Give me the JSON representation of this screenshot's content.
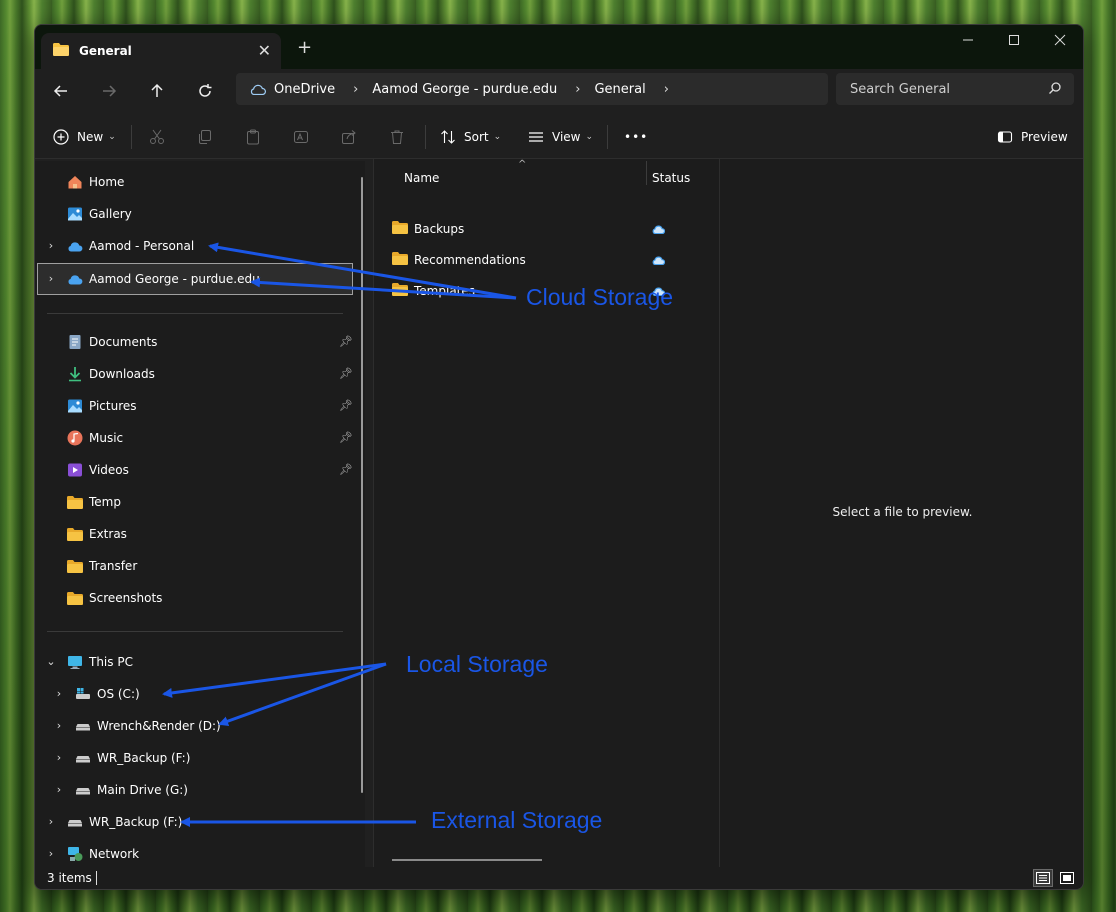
{
  "window": {
    "tab_title": "General",
    "new_tab_symbol": "+",
    "close_tab_symbol": "✕"
  },
  "nav": {
    "breadcrumbs": [
      "OneDrive",
      "Aamod George - purdue.edu",
      "General"
    ],
    "search_placeholder": "Search General"
  },
  "toolbar": {
    "new_label": "New",
    "sort_label": "Sort",
    "view_label": "View",
    "more_label": "•••",
    "preview_label": "Preview"
  },
  "sidebar": {
    "quick": [
      {
        "label": "Home",
        "icon": "home-icon"
      },
      {
        "label": "Gallery",
        "icon": "gallery-icon"
      },
      {
        "label": "Aamod - Personal",
        "icon": "onedrive-icon"
      },
      {
        "label": "Aamod George - purdue.edu",
        "icon": "onedrive-icon"
      }
    ],
    "pinned": [
      {
        "label": "Documents",
        "icon": "documents-icon"
      },
      {
        "label": "Downloads",
        "icon": "downloads-icon"
      },
      {
        "label": "Pictures",
        "icon": "pictures-icon"
      },
      {
        "label": "Music",
        "icon": "music-icon"
      },
      {
        "label": "Videos",
        "icon": "videos-icon"
      },
      {
        "label": "Temp",
        "icon": "folder-icon"
      },
      {
        "label": "Extras",
        "icon": "folder-icon"
      },
      {
        "label": "Transfer",
        "icon": "folder-icon"
      },
      {
        "label": "Screenshots",
        "icon": "folder-icon"
      }
    ],
    "this_pc": "This PC",
    "drives": [
      {
        "label": "OS (C:)",
        "icon": "os-drive-icon"
      },
      {
        "label": "Wrench&Render (D:)",
        "icon": "drive-icon"
      },
      {
        "label": "WR_Backup (F:)",
        "icon": "drive-icon"
      },
      {
        "label": "Main Drive (G:)",
        "icon": "drive-icon"
      }
    ],
    "external": {
      "label": "WR_Backup (F:)",
      "icon": "drive-icon"
    },
    "network": {
      "label": "Network",
      "icon": "network-icon"
    }
  },
  "filelist": {
    "col_name": "Name",
    "col_status": "Status",
    "files": [
      {
        "name": "Backups",
        "status": "cloud-only"
      },
      {
        "name": "Recommendations",
        "status": "cloud-only"
      },
      {
        "name": "Templates",
        "status": "cloud-only"
      }
    ]
  },
  "preview": {
    "message": "Select a file to preview."
  },
  "status": {
    "items": "3 items"
  },
  "annotations": {
    "cloud": "Cloud Storage",
    "local": "Local Storage",
    "external": "External Storage"
  },
  "colors": {
    "accent": "#1a56e6",
    "folder": "#f6c343",
    "onedrive": "#4aa3f0"
  }
}
